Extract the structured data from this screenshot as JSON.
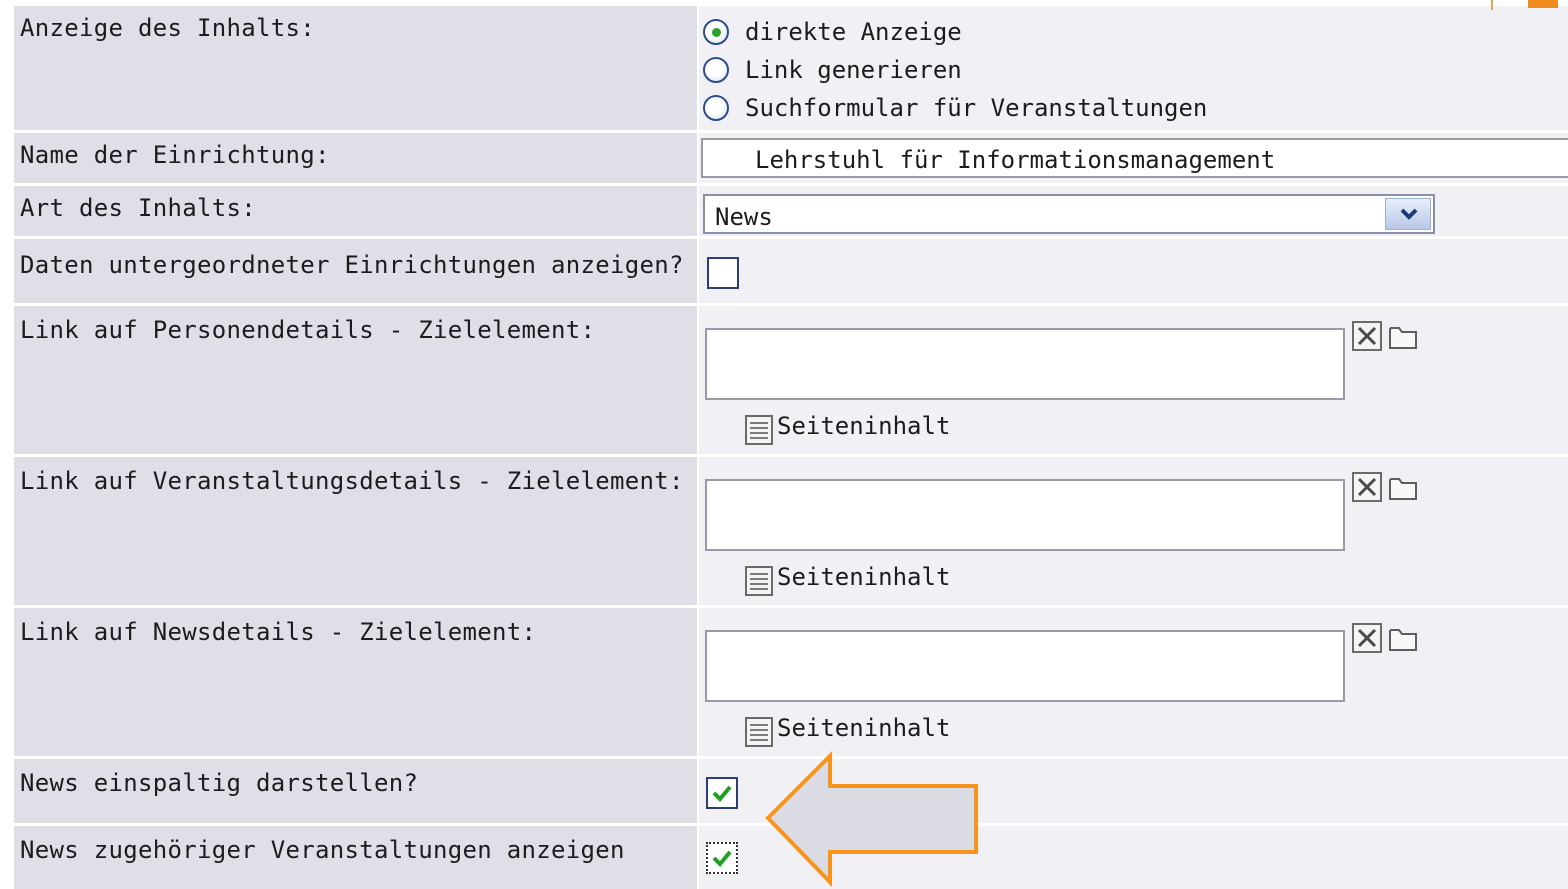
{
  "content_display": {
    "label": "Anzeige des Inhalts:",
    "options": [
      {
        "label": "direkte Anzeige",
        "selected": true
      },
      {
        "label": "Link generieren",
        "selected": false
      },
      {
        "label": "Suchformular für Veranstaltungen",
        "selected": false
      }
    ]
  },
  "institution": {
    "label": "Name der Einrichtung:",
    "value": "Lehrstuhl für Informationsmanagement"
  },
  "content_type": {
    "label": "Art des Inhalts:",
    "value": "News"
  },
  "sub_institutions": {
    "label": "Daten untergeordneter Einrichtungen anzeigen?",
    "checked": false
  },
  "link_fields": [
    {
      "label": "Link auf Personendetails - Zielelement:",
      "value": "",
      "page_link": "Seiteninhalt"
    },
    {
      "label": "Link auf Veranstaltungsdetails - Zielelement:",
      "value": "",
      "page_link": "Seiteninhalt"
    },
    {
      "label": "Link auf Newsdetails - Zielelement:",
      "value": "",
      "page_link": "Seiteninhalt"
    }
  ],
  "news_single_column": {
    "label": "News einspaltig darstellen?",
    "checked": true
  },
  "news_events": {
    "label": "News zugehöriger Veranstaltungen anzeigen",
    "checked": true
  },
  "annotation": {
    "arrow_color": "#f7941d"
  }
}
